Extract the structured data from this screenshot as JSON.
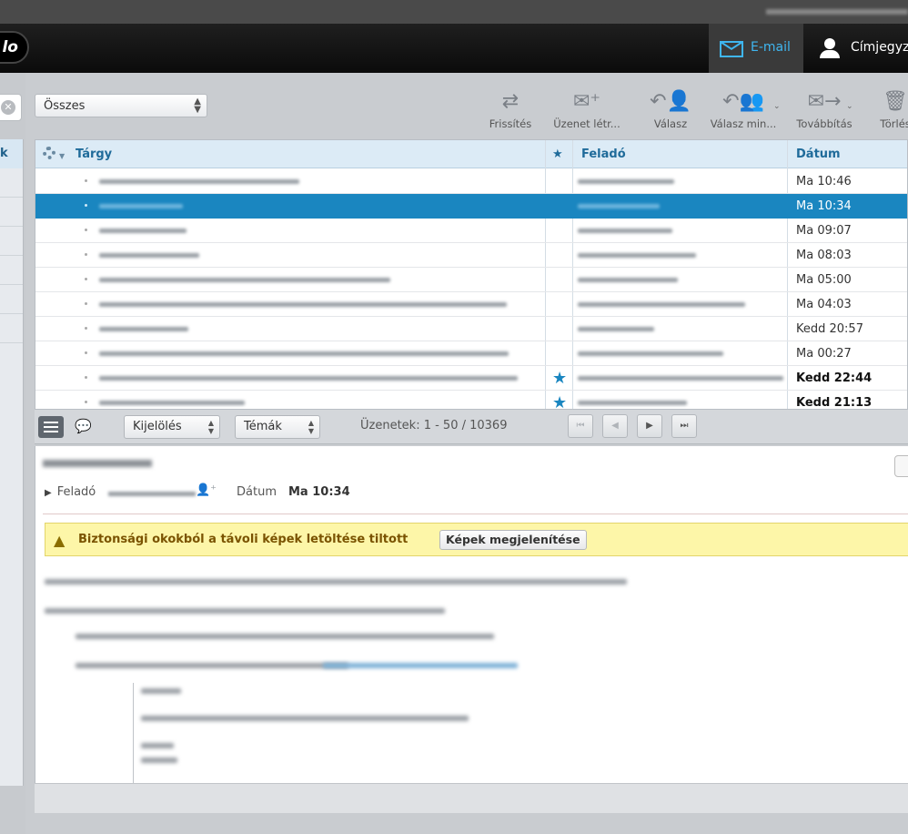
{
  "header": {
    "logo_text": "lo",
    "nav": {
      "email_label": "E-mail",
      "contacts_label": "Címjegyz"
    }
  },
  "toolbar": {
    "filter_value": "Összes",
    "buttons": [
      {
        "label": "Frissítés",
        "icon": "refresh-icon"
      },
      {
        "label": "Üzenet létr...",
        "icon": "compose-icon"
      },
      {
        "label": "Válasz",
        "icon": "reply-icon"
      },
      {
        "label": "Válasz min...",
        "icon": "reply-all-icon"
      },
      {
        "label": "Továbbítás",
        "icon": "forward-icon"
      },
      {
        "label": "Törlés",
        "icon": "trash-icon"
      }
    ]
  },
  "sidebar": {
    "header_label": "k"
  },
  "list": {
    "columns": {
      "subject": "Tárgy",
      "flag": "★",
      "from": "Feladó",
      "date": "Dátum"
    },
    "rows": [
      {
        "date": "Ma 10:46",
        "selected": false,
        "flagged": false,
        "unread": false
      },
      {
        "date": "Ma 10:34",
        "selected": true,
        "flagged": false,
        "unread": false
      },
      {
        "date": "Ma 09:07",
        "selected": false,
        "flagged": false,
        "unread": false
      },
      {
        "date": "Ma 08:03",
        "selected": false,
        "flagged": false,
        "unread": false
      },
      {
        "date": "Ma 05:00",
        "selected": false,
        "flagged": false,
        "unread": false
      },
      {
        "date": "Ma 04:03",
        "selected": false,
        "flagged": false,
        "unread": false
      },
      {
        "date": "Kedd 20:57",
        "selected": false,
        "flagged": false,
        "unread": false
      },
      {
        "date": "Ma 00:27",
        "selected": false,
        "flagged": false,
        "unread": false
      },
      {
        "date": "Kedd 22:44",
        "selected": false,
        "flagged": true,
        "unread": true
      },
      {
        "date": "Kedd 21:13",
        "selected": false,
        "flagged": true,
        "unread": true
      }
    ]
  },
  "list_footer": {
    "select_label": "Kijelölés",
    "threads_label": "Témák",
    "count_text": "Üzenetek: 1 - 50 / 10369"
  },
  "preview": {
    "from_label": "Feladó",
    "date_label": "Dátum",
    "date_value": "Ma 10:34",
    "warning_text": "Biztonsági okokból a távoli képek letöltése tiltott",
    "show_images_label": "Képek megjelenítése"
  },
  "colors": {
    "accent": "#1a86c0",
    "nav_active": "#3fb6f0",
    "warning_bg": "#fdf6a8"
  }
}
